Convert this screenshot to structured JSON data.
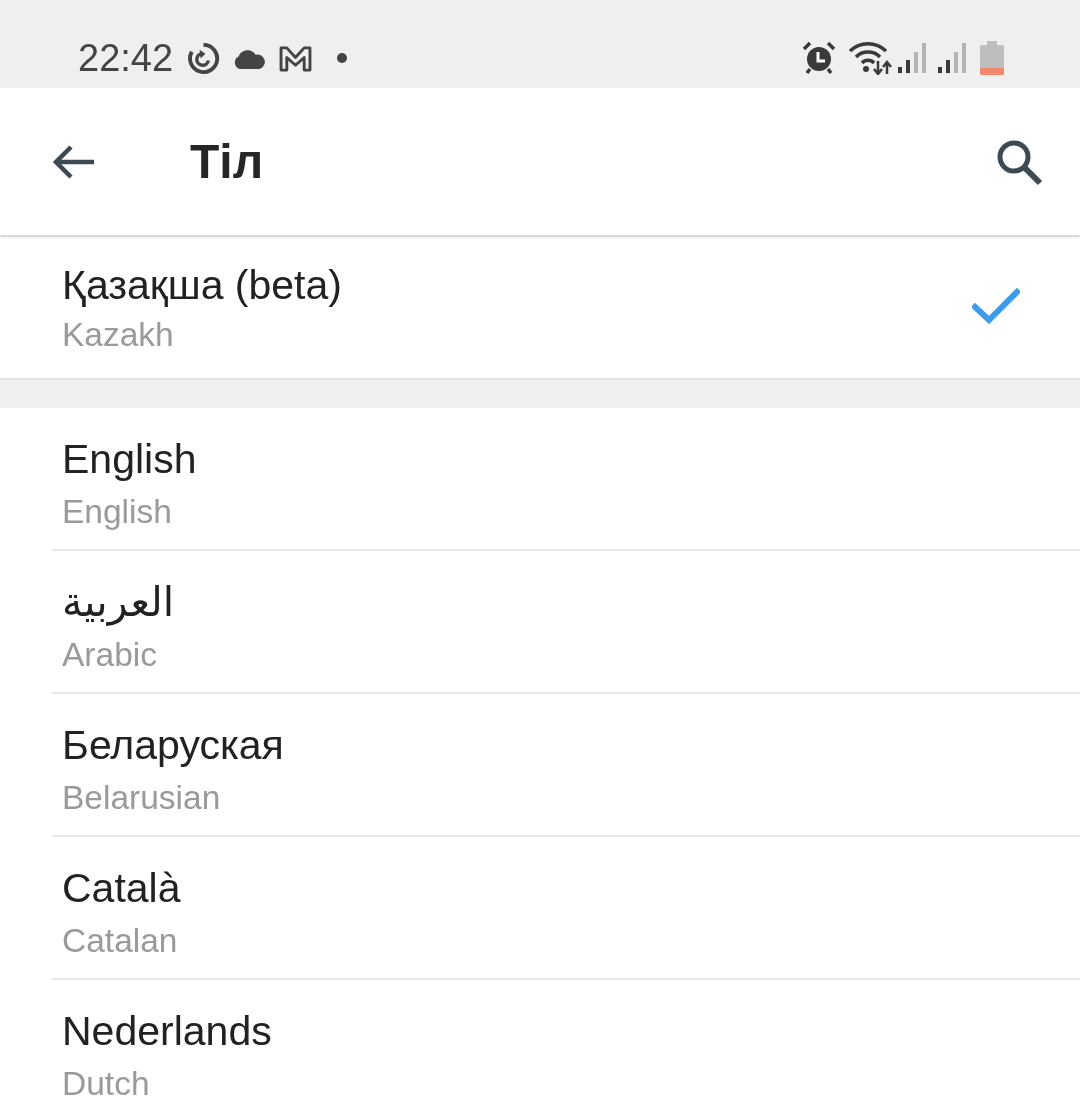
{
  "status_bar": {
    "time": "22:42"
  },
  "toolbar": {
    "title": "Тіл"
  },
  "current_language": {
    "name": "Қазақша (beta)",
    "english_name": "Kazakh",
    "selected": true
  },
  "languages": [
    {
      "name": "English",
      "english_name": "English",
      "selected": false
    },
    {
      "name": "العربية",
      "english_name": "Arabic",
      "selected": false
    },
    {
      "name": "Беларуская",
      "english_name": "Belarusian",
      "selected": false
    },
    {
      "name": "Català",
      "english_name": "Catalan",
      "selected": false
    },
    {
      "name": "Nederlands",
      "english_name": "Dutch",
      "selected": false
    }
  ]
}
